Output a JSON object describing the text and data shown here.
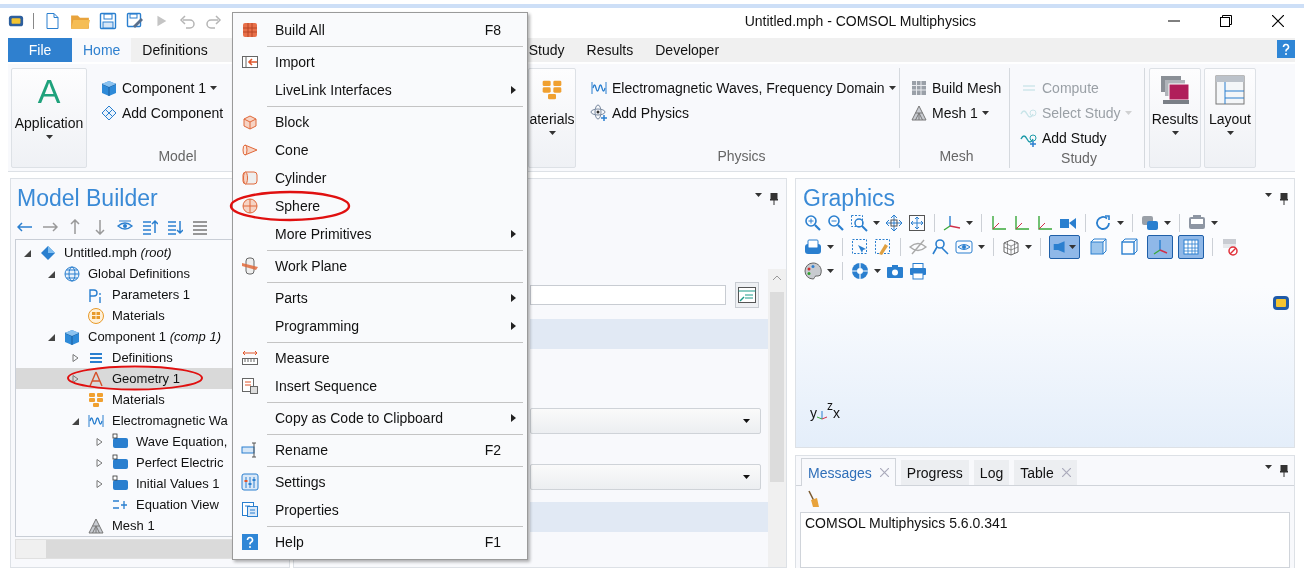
{
  "window": {
    "title": "Untitled.mph - COMSOL Multiphysics"
  },
  "ribbon_tabs": [
    {
      "label": "File",
      "kind": "file",
      "selected": false
    },
    {
      "label": "Home",
      "kind": "tab",
      "selected": true
    },
    {
      "label": "Definitions",
      "kind": "tab",
      "selected": false
    },
    {
      "label": "Study",
      "kind": "tab",
      "selected": false
    },
    {
      "label": "Results",
      "kind": "tab",
      "selected": false
    },
    {
      "label": "Developer",
      "kind": "tab",
      "selected": false
    }
  ],
  "ribbon": {
    "groups": [
      {
        "label": "Model",
        "buttons": [
          {
            "label": "Application",
            "glyph": "A",
            "kind": "large",
            "dropdown": true,
            "disabled": false
          },
          {
            "label": "Component 1",
            "kind": "small",
            "dropdown": true,
            "disabled": false
          },
          {
            "label": "Add Component",
            "kind": "small",
            "dropdown": false,
            "disabled": false
          }
        ]
      },
      {
        "buttons": [
          {
            "label": "aterials",
            "kind": "large",
            "dropdown": true,
            "disabled": false
          }
        ]
      },
      {
        "label": "Physics",
        "buttons": [
          {
            "label": "Electromagnetic Waves, Frequency Domain",
            "kind": "small",
            "dropdown": true,
            "disabled": false
          },
          {
            "label": "Add Physics",
            "kind": "small",
            "dropdown": false,
            "disabled": false
          }
        ]
      },
      {
        "label": "Mesh",
        "buttons": [
          {
            "label": "Build Mesh",
            "kind": "small",
            "dropdown": false,
            "disabled": false
          },
          {
            "label": "Mesh 1",
            "kind": "small",
            "dropdown": true,
            "disabled": false
          }
        ]
      },
      {
        "label": "Study",
        "buttons": [
          {
            "label": "Compute",
            "kind": "small",
            "dropdown": false,
            "disabled": true
          },
          {
            "label": "Select Study",
            "kind": "small",
            "dropdown": true,
            "disabled": true
          },
          {
            "label": "Add Study",
            "kind": "small",
            "dropdown": false,
            "disabled": false
          }
        ]
      },
      {
        "buttons": [
          {
            "label": "Results",
            "kind": "large",
            "dropdown": true,
            "disabled": false
          },
          {
            "label": "Layout",
            "kind": "large",
            "dropdown": true,
            "disabled": false
          }
        ]
      }
    ]
  },
  "model_builder": {
    "title": "Model Builder",
    "tree": [
      {
        "label": "Untitled.mph *(root)*",
        "kind": "root",
        "expanded": true,
        "selected": false,
        "circled": false,
        "children": [
          {
            "label": "Global Definitions",
            "kind": "global",
            "expanded": true,
            "selected": false,
            "circled": false,
            "children": [
              {
                "label": "Parameters 1",
                "kind": "parameters",
                "selected": false,
                "circled": false
              },
              {
                "label": "Materials",
                "kind": "global-materials",
                "selected": false,
                "circled": false
              }
            ]
          },
          {
            "label": "Component 1 *(comp 1)*",
            "kind": "component",
            "expanded": true,
            "selected": false,
            "circled": false,
            "children": [
              {
                "label": "Definitions",
                "kind": "definitions",
                "expanded": false,
                "selected": false,
                "circled": false
              },
              {
                "label": "Geometry 1",
                "kind": "geometry",
                "expanded": false,
                "selected": true,
                "circled": true
              },
              {
                "label": "Materials",
                "kind": "materials",
                "selected": false,
                "circled": false
              },
              {
                "label": "Electromagnetic Wa",
                "kind": "physics",
                "expanded": true,
                "selected": false,
                "circled": false,
                "children": [
                  {
                    "label": "Wave Equation,",
                    "kind": "physics-node",
                    "expanded": false,
                    "selected": false,
                    "circled": false
                  },
                  {
                    "label": "Perfect Electric",
                    "kind": "physics-node",
                    "expanded": false,
                    "selected": false,
                    "circled": false
                  },
                  {
                    "label": "Initial Values 1",
                    "kind": "physics-node",
                    "expanded": false,
                    "selected": false,
                    "circled": false
                  },
                  {
                    "label": "Equation View",
                    "kind": "equation",
                    "selected": false,
                    "circled": false
                  }
                ]
              },
              {
                "label": "Mesh 1",
                "kind": "mesh",
                "selected": false,
                "circled": false
              }
            ]
          }
        ]
      }
    ]
  },
  "context_menu": {
    "items": [
      {
        "label": "Build All",
        "shortcut": "F8",
        "submenu": false,
        "circled": false,
        "separator_after": true
      },
      {
        "label": "Import",
        "submenu": false,
        "circled": false,
        "separator_after": false
      },
      {
        "label": "LiveLink Interfaces",
        "submenu": true,
        "circled": false,
        "separator_after": true
      },
      {
        "label": "Block",
        "submenu": false,
        "circled": false,
        "separator_after": false
      },
      {
        "label": "Cone",
        "submenu": false,
        "circled": false,
        "separator_after": false
      },
      {
        "label": "Cylinder",
        "submenu": false,
        "circled": false,
        "separator_after": false
      },
      {
        "label": "Sphere",
        "submenu": false,
        "circled": true,
        "separator_after": false
      },
      {
        "label": "More Primitives",
        "submenu": true,
        "circled": false,
        "separator_after": true
      },
      {
        "label": "Work Plane",
        "submenu": false,
        "circled": false,
        "separator_after": true
      },
      {
        "label": "Parts",
        "submenu": true,
        "circled": false,
        "separator_after": false
      },
      {
        "label": "Programming",
        "submenu": true,
        "circled": false,
        "separator_after": true
      },
      {
        "label": "Measure",
        "submenu": false,
        "circled": false,
        "separator_after": false
      },
      {
        "label": "Insert Sequence",
        "submenu": false,
        "circled": false,
        "separator_after": true
      },
      {
        "label": "Copy as Code to Clipboard",
        "submenu": true,
        "circled": false,
        "separator_after": true
      },
      {
        "label": "Rename",
        "shortcut": "F2",
        "submenu": false,
        "circled": false,
        "separator_after": true
      },
      {
        "label": "Settings",
        "submenu": false,
        "circled": false,
        "separator_after": false
      },
      {
        "label": "Properties",
        "submenu": false,
        "circled": false,
        "separator_after": true
      },
      {
        "label": "Help",
        "shortcut": "F1",
        "submenu": false,
        "circled": false,
        "separator_after": false
      }
    ]
  },
  "graphics": {
    "title": "Graphics",
    "view_toggles": [
      {
        "on": true
      },
      {
        "on": false
      },
      {
        "on": false
      },
      {
        "on": true
      },
      {
        "on": true
      }
    ],
    "triad": {
      "y": "y",
      "z": "z",
      "x": "x"
    }
  },
  "messages": {
    "tabs": [
      {
        "label": "Messages",
        "selected": true,
        "closable": true
      },
      {
        "label": "Progress",
        "selected": false,
        "closable": false
      },
      {
        "label": "Log",
        "selected": false,
        "closable": false
      },
      {
        "label": "Table",
        "selected": false,
        "closable": true
      }
    ],
    "lines": [
      "COMSOL Multiphysics 5.6.0.341"
    ]
  }
}
